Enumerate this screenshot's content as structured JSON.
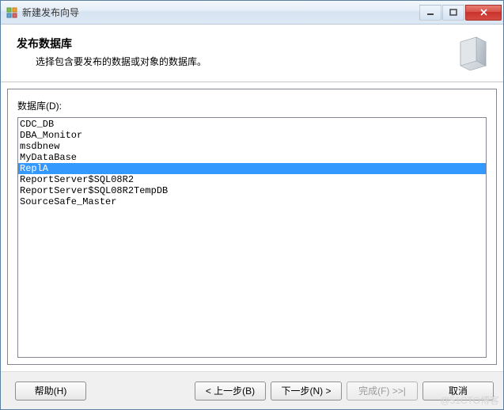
{
  "window": {
    "title": "新建发布向导"
  },
  "header": {
    "title": "发布数据库",
    "subtitle": "选择包含要发布的数据或对象的数据库。"
  },
  "content": {
    "list_label": "数据库(D):",
    "databases": [
      "CDC_DB",
      "DBA_Monitor",
      "msdbnew",
      "MyDataBase",
      "ReplA",
      "ReportServer$SQL08R2",
      "ReportServer$SQL08R2TempDB",
      "SourceSafe_Master"
    ],
    "selected_index": 4
  },
  "footer": {
    "help": "帮助(H)",
    "back": "< 上一步(B)",
    "next": "下一步(N) >",
    "finish": "完成(F) >>|",
    "cancel": "取消"
  },
  "watermark": "@51CTO博客"
}
